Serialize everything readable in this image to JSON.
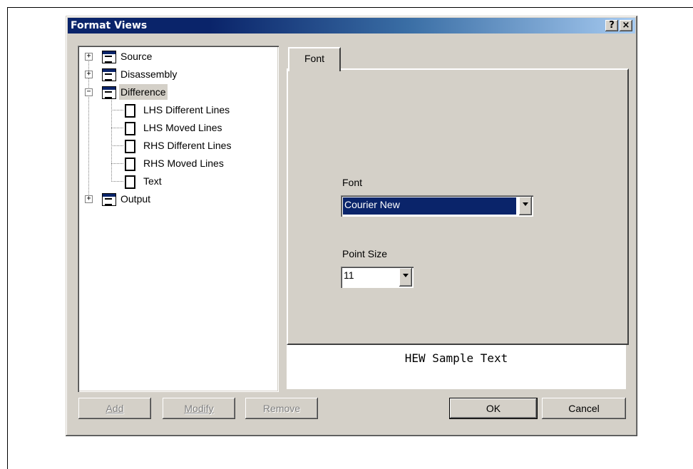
{
  "window": {
    "title": "Format Views"
  },
  "titlebar": {
    "help_label": "?",
    "close_label": "×"
  },
  "tree": {
    "items": [
      {
        "label": "Source",
        "expander": "+"
      },
      {
        "label": "Disassembly",
        "expander": "+"
      },
      {
        "label": "Difference",
        "expander": "−"
      },
      {
        "label": "LHS Different Lines"
      },
      {
        "label": "LHS Moved Lines"
      },
      {
        "label": "RHS Different Lines"
      },
      {
        "label": "RHS Moved Lines"
      },
      {
        "label": "Text"
      },
      {
        "label": "Output",
        "expander": "+"
      }
    ]
  },
  "tabs": [
    {
      "label": "Font"
    }
  ],
  "font_section": {
    "font_label": "Font",
    "font_value": "Courier New",
    "size_label": "Point Size",
    "size_value": "11"
  },
  "sample_text": "HEW Sample Text",
  "buttons": {
    "add_label": "Add",
    "modify_label": "Modify",
    "remove_label": "Remove",
    "ok_label": "OK",
    "cancel_label": "Cancel"
  }
}
